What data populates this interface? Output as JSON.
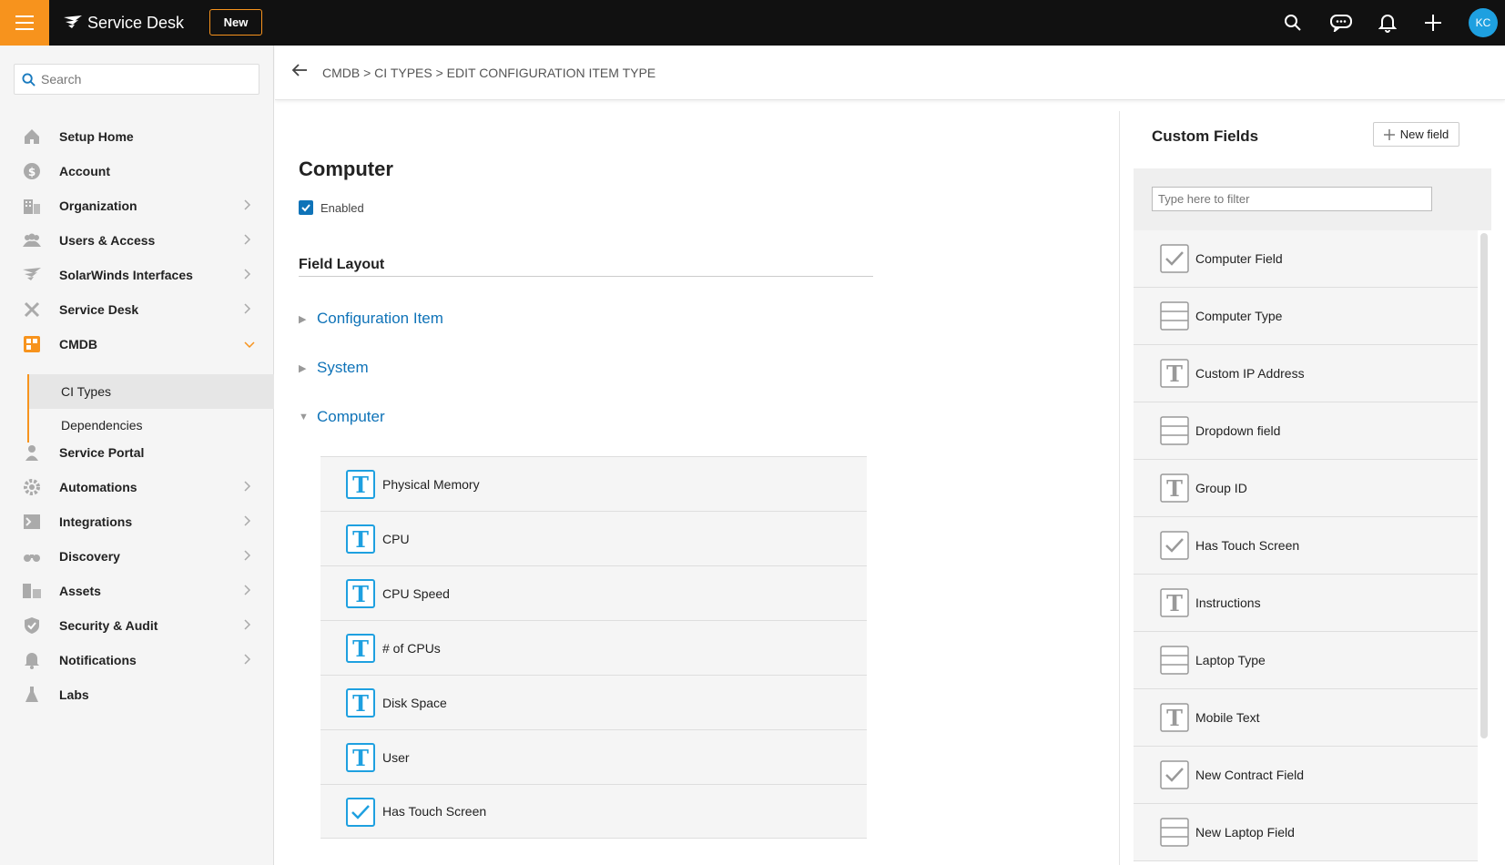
{
  "topbar": {
    "brand": "Service Desk",
    "new_label": "New",
    "avatar_initials": "KC",
    "accent_color": "#f7931d"
  },
  "sidebar": {
    "search_placeholder": "Search",
    "items": [
      {
        "label": "Setup Home",
        "icon": "home-icon",
        "chevron": false
      },
      {
        "label": "Account",
        "icon": "dollar-icon",
        "chevron": false
      },
      {
        "label": "Organization",
        "icon": "building-icon",
        "chevron": true
      },
      {
        "label": "Users & Access",
        "icon": "users-icon",
        "chevron": true
      },
      {
        "label": "SolarWinds Interfaces",
        "icon": "solarwinds-icon",
        "chevron": true
      },
      {
        "label": "Service Desk",
        "icon": "tools-icon",
        "chevron": true
      },
      {
        "label": "CMDB",
        "icon": "cmdb-icon",
        "chevron": true,
        "expanded": true
      },
      {
        "label": "Service Portal",
        "icon": "portal-icon",
        "chevron": false
      },
      {
        "label": "Automations",
        "icon": "gear-icon",
        "chevron": true
      },
      {
        "label": "Integrations",
        "icon": "terminal-icon",
        "chevron": true
      },
      {
        "label": "Discovery",
        "icon": "binoculars-icon",
        "chevron": true
      },
      {
        "label": "Assets",
        "icon": "assets-icon",
        "chevron": true
      },
      {
        "label": "Security & Audit",
        "icon": "shield-icon",
        "chevron": true
      },
      {
        "label": "Notifications",
        "icon": "bell-icon",
        "chevron": true
      },
      {
        "label": "Labs",
        "icon": "flask-icon",
        "chevron": false
      }
    ],
    "cmdb_subitems": [
      {
        "label": "CI Types",
        "active": true
      },
      {
        "label": "Dependencies",
        "active": false
      }
    ]
  },
  "breadcrumb": "CMDB > CI TYPES > EDIT CONFIGURATION ITEM TYPE",
  "main": {
    "title": "Computer",
    "enabled_label": "Enabled",
    "enabled_checked": true,
    "field_layout_heading": "Field Layout",
    "groups": [
      {
        "label": "Configuration Item",
        "expanded": false
      },
      {
        "label": "System",
        "expanded": false
      },
      {
        "label": "Computer",
        "expanded": true
      }
    ],
    "computer_fields": [
      {
        "label": "Physical Memory",
        "type": "text"
      },
      {
        "label": "CPU",
        "type": "text"
      },
      {
        "label": "CPU Speed",
        "type": "text"
      },
      {
        "label": "# of CPUs",
        "type": "text"
      },
      {
        "label": "Disk Space",
        "type": "text"
      },
      {
        "label": "User",
        "type": "text"
      },
      {
        "label": "Has Touch Screen",
        "type": "checkbox"
      }
    ]
  },
  "custom_fields": {
    "title": "Custom Fields",
    "new_field_label": "New field",
    "filter_placeholder": "Type here to filter",
    "items": [
      {
        "label": "Computer Field",
        "type": "checkbox"
      },
      {
        "label": "Computer Type",
        "type": "dropdown"
      },
      {
        "label": "Custom IP Address",
        "type": "text"
      },
      {
        "label": "Dropdown field",
        "type": "dropdown"
      },
      {
        "label": "Group ID",
        "type": "text"
      },
      {
        "label": "Has Touch Screen",
        "type": "checkbox"
      },
      {
        "label": "Instructions",
        "type": "text"
      },
      {
        "label": "Laptop Type",
        "type": "dropdown"
      },
      {
        "label": "Mobile Text",
        "type": "text"
      },
      {
        "label": "New Contract Field",
        "type": "checkbox"
      },
      {
        "label": "New Laptop Field",
        "type": "dropdown"
      }
    ]
  }
}
